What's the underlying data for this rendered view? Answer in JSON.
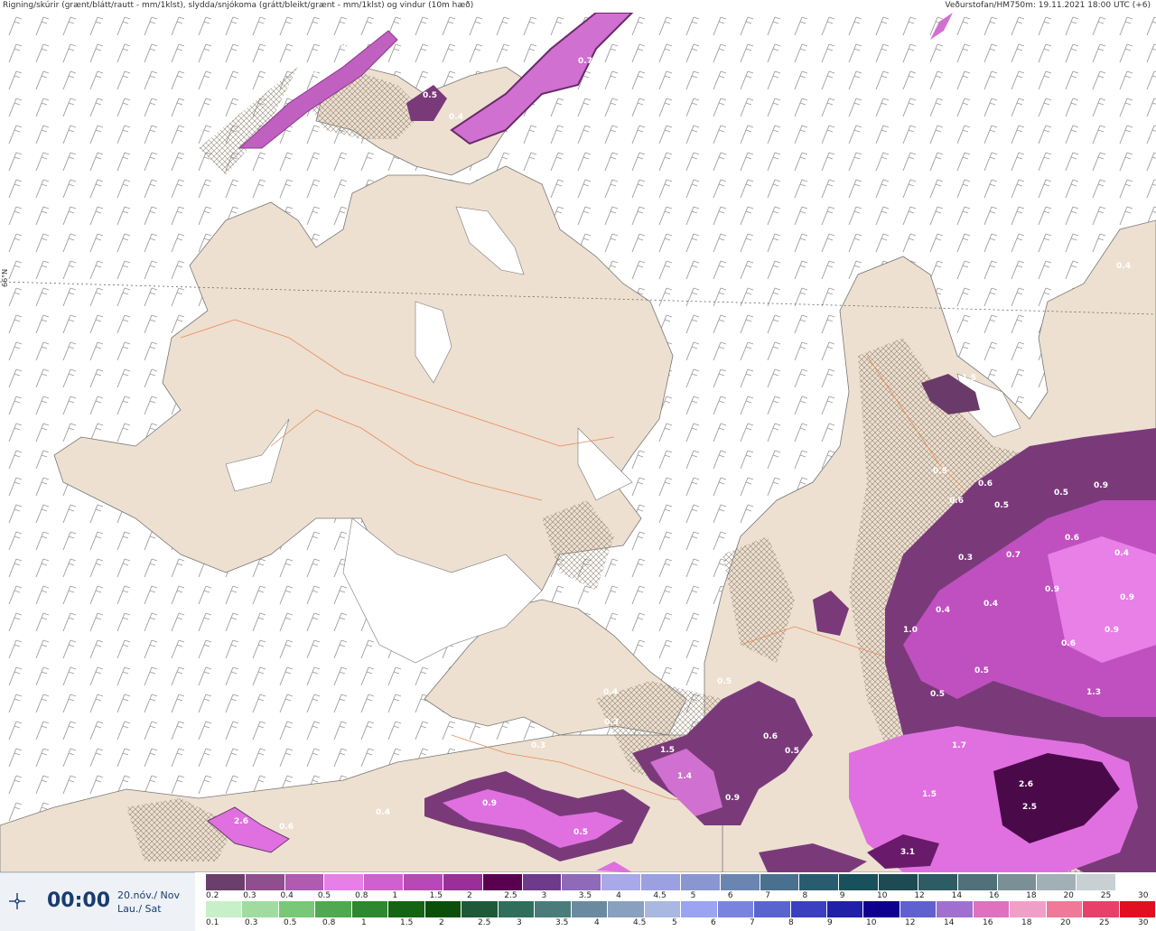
{
  "header": {
    "left_text": "Rigning/skúrir (grænt/blátt/rautt - mm/1klst), slydda/snjókoma (grátt/bleikt/grænt - mm/1klst) og vindur (10m hæð)",
    "right_text": "Veðurstofan/HM750m: 19.11.2021 18:00 UTC (+6)"
  },
  "map": {
    "lat_label": "66°N",
    "precip_labels": [
      {
        "text": "0.5"
      },
      {
        "text": "0.6"
      },
      {
        "text": "1.6"
      },
      {
        "text": "0.7"
      },
      {
        "text": "0.5"
      },
      {
        "text": "0.4"
      },
      {
        "text": "1.5"
      },
      {
        "text": "0.5"
      },
      {
        "text": "0.6"
      },
      {
        "text": "0.6"
      },
      {
        "text": "0.5"
      },
      {
        "text": "0.5"
      },
      {
        "text": "0.6"
      },
      {
        "text": "0.9"
      },
      {
        "text": "0.4"
      },
      {
        "text": "0.3"
      },
      {
        "text": "0.7"
      },
      {
        "text": "0.4"
      },
      {
        "text": "0.9"
      },
      {
        "text": "0.4"
      },
      {
        "text": "0.9"
      },
      {
        "text": "1.0"
      },
      {
        "text": "0.6"
      },
      {
        "text": "0.9"
      },
      {
        "text": "0.5"
      },
      {
        "text": "0.5"
      },
      {
        "text": "1.3"
      },
      {
        "text": "0.5"
      },
      {
        "text": "0.6"
      },
      {
        "text": "0.5"
      },
      {
        "text": "1.7"
      },
      {
        "text": "1.5"
      },
      {
        "text": "1.4"
      },
      {
        "text": "0.9"
      },
      {
        "text": "2.6"
      },
      {
        "text": "2.5"
      },
      {
        "text": "1.5"
      },
      {
        "text": "3.1"
      },
      {
        "text": "0.4"
      },
      {
        "text": "0.3"
      },
      {
        "text": "0.3"
      },
      {
        "text": "0.9"
      },
      {
        "text": "0.4"
      },
      {
        "text": "0.5"
      },
      {
        "text": "2.6"
      },
      {
        "text": "0.6"
      },
      {
        "text": "0.4"
      }
    ]
  },
  "timebox": {
    "icon": "wind-compass-icon",
    "time": "00:00",
    "date_line1": "20.nóv./ Nov",
    "date_line2": "Lau./ Sat"
  },
  "legend_snow": {
    "colors": [
      "#6b3f6b",
      "#8f4f8f",
      "#b05ab0",
      "#e87ee8",
      "#d060d0",
      "#b848b8",
      "#9a2e9a",
      "#5a0050",
      "#6e3a8a",
      "#8e6ab8",
      "#a9a9e8",
      "#9aa0e0",
      "#8a96d0",
      "#6a86b0",
      "#4a7090",
      "#2a5c70",
      "#18505c",
      "#1e4a54",
      "#2e5c64",
      "#50707a",
      "#7a9096",
      "#a0b0b4",
      "#c8d0d4",
      "#ffffff"
    ],
    "labels": [
      "0.2",
      "0.3",
      "0.4",
      "0.5",
      "0.8",
      "1",
      "1.5",
      "2",
      "2.5",
      "3",
      "3.5",
      "4",
      "4.5",
      "5",
      "6",
      "7",
      "8",
      "9",
      "10",
      "12",
      "14",
      "16",
      "18",
      "20",
      "25",
      "30"
    ]
  },
  "legend_rain": {
    "colors": [
      "#c8f0c8",
      "#a0dca0",
      "#78c878",
      "#50a850",
      "#2e882e",
      "#146414",
      "#0a500a",
      "#1e5a3a",
      "#2e6e5a",
      "#4a7c7c",
      "#6a8aa0",
      "#8aa0c0",
      "#a8b8e0",
      "#9aa4f0",
      "#7a84e0",
      "#5a64d0",
      "#3a40c0",
      "#2020a8",
      "#100090",
      "#6060d0",
      "#a070d0",
      "#e070c0",
      "#f0a0c8",
      "#f07898",
      "#e84068",
      "#e01020"
    ],
    "labels": [
      "0.1",
      "0.3",
      "0.5",
      "0.8",
      "1",
      "1.5",
      "2",
      "2.5",
      "3",
      "3.5",
      "4",
      "4.5",
      "5",
      "6",
      "7",
      "8",
      "9",
      "10",
      "12",
      "14",
      "16",
      "18",
      "20",
      "25",
      "30"
    ]
  }
}
